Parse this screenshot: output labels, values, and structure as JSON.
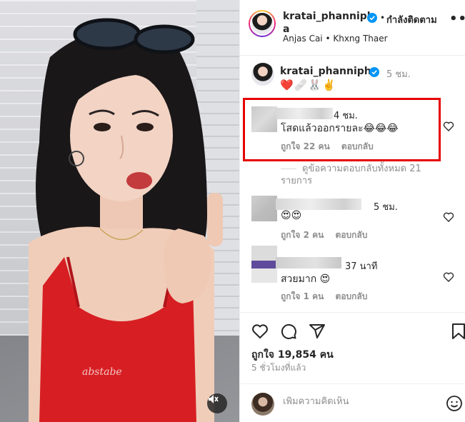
{
  "post": {
    "username": "kratai_phannipha",
    "follow_label": "กำลังติดตาม",
    "audio": "Anjas Cai • Khxng Thaer",
    "more_label": "•••"
  },
  "caption": {
    "username": "kratai_phannipha",
    "time": "5 ชม.",
    "text": "❤️🩹🐰✌️"
  },
  "comments": [
    {
      "time": "4 ชม.",
      "text": "โสดแล้วออกรายละ😂😂😂",
      "likes": "ถูกใจ 22 คน",
      "reply": "ตอบกลับ"
    },
    {
      "time": "5 ชม.",
      "text": "😍😍",
      "likes": "ถูกใจ 2 คน",
      "reply": "ตอบกลับ"
    },
    {
      "time": "37 นาที",
      "text": "สวยมาก 😍",
      "likes": "ถูกใจ 1 คน",
      "reply": "ตอบกลับ"
    }
  ],
  "view_replies": "ดูข้อความตอบกลับทั้งหมด 21 รายการ",
  "actions": {
    "likes": "ถูกใจ 19,854 คน",
    "ago": "5 ชั่วโมงที่แล้ว"
  },
  "add_comment": {
    "placeholder": "เพิ่มความคิดเห็น"
  },
  "colors": {
    "highlight": "#e60000",
    "verified": "#0095f6"
  },
  "icons": [
    "heart-icon",
    "comment-icon",
    "share-icon",
    "bookmark-icon",
    "mute-icon",
    "emoji-icon",
    "verified-icon"
  ]
}
